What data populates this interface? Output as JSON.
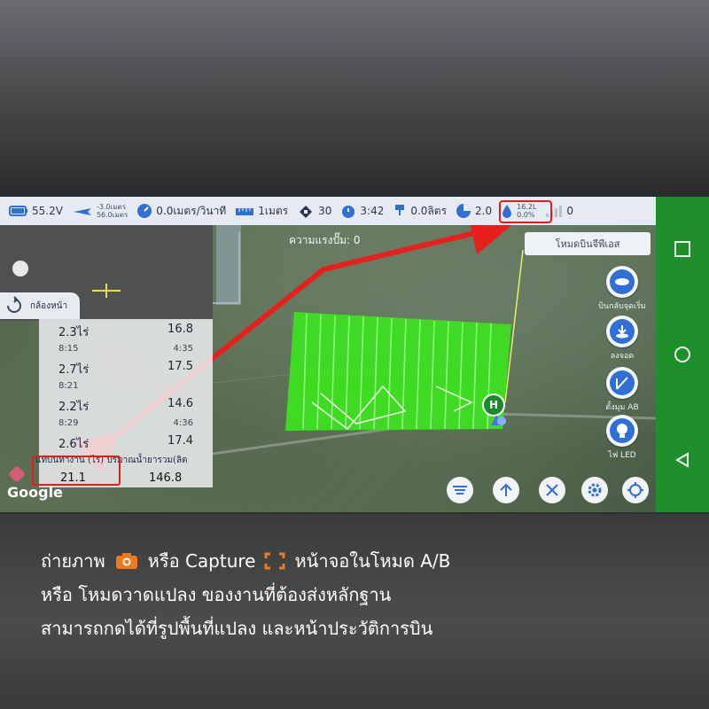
{
  "status_bar": {
    "battery_voltage": "55.2V",
    "altitude_top": "-3.0เมตร",
    "altitude_bottom": "56.0เมตร",
    "speed": "0.0เมตร/วินาที",
    "height": "1เมตร",
    "satellites": "30",
    "flight_time": "3:42",
    "flow": "0.0ลิตร",
    "area": "2.0",
    "tank_top": "16.2L",
    "tank_bottom": "0.0%",
    "signal": "0",
    "highlight_color": "#e31b1b"
  },
  "map": {
    "pump_pressure": "ความแรงปั๊ม: 0",
    "gps_mode_button": "โหมดบินจีพีเอส",
    "home_marker": "H",
    "front_camera_tab": "กล้องหน้า",
    "google_logo": "Google",
    "field_color": "#3de021",
    "arrow_color": "#e8201d"
  },
  "history": {
    "rows": [
      {
        "left": "2.3ไร่",
        "right": "16.8",
        "kind": "big"
      },
      {
        "left": "8:15",
        "right": "4:35",
        "kind": "small"
      },
      {
        "left": "2.7ไร่",
        "right": "17.5",
        "kind": "big"
      },
      {
        "left": "8:21",
        "right": "",
        "kind": "small"
      },
      {
        "left": "2.2ไร่",
        "right": "14.6",
        "kind": "big"
      },
      {
        "left": "8:29",
        "right": "4:36",
        "kind": "small"
      },
      {
        "left": "2.6ไร่",
        "right": "17.4",
        "kind": "big"
      }
    ],
    "footer_header": "แท้บินทำงาน (ไร่) ปริมาณน้ำยารวม(ลิต",
    "total_area": "21.1",
    "total_liquid": "146.8"
  },
  "side_buttons": [
    {
      "label": "บินกลับจุดเริ่ม",
      "icon": "drone-return-icon"
    },
    {
      "label": "ลงจอด",
      "icon": "landing-icon"
    },
    {
      "label": "ตั้งมุม AB",
      "icon": "ab-angle-icon"
    },
    {
      "label": "ไฟ LED",
      "icon": "led-light-icon"
    }
  ],
  "bottom_buttons": [
    "route-icon",
    "ascend-icon",
    "disarm-icon",
    "settings-icon",
    "locate-icon"
  ],
  "caption": {
    "line1_a": "ถ่ายภาพ",
    "line1_b": "หรือ Capture",
    "line1_c": "หน้าจอในโหมด A/B",
    "line2": "หรือ โหมดวาดแปลง ของงานที่ต้องส่งหลักฐาน",
    "line3": "สามารถกดได้ที่รูปพื้นที่แปลง และหน้าประวัติการบิน",
    "icon_color": "#f07a1a"
  }
}
